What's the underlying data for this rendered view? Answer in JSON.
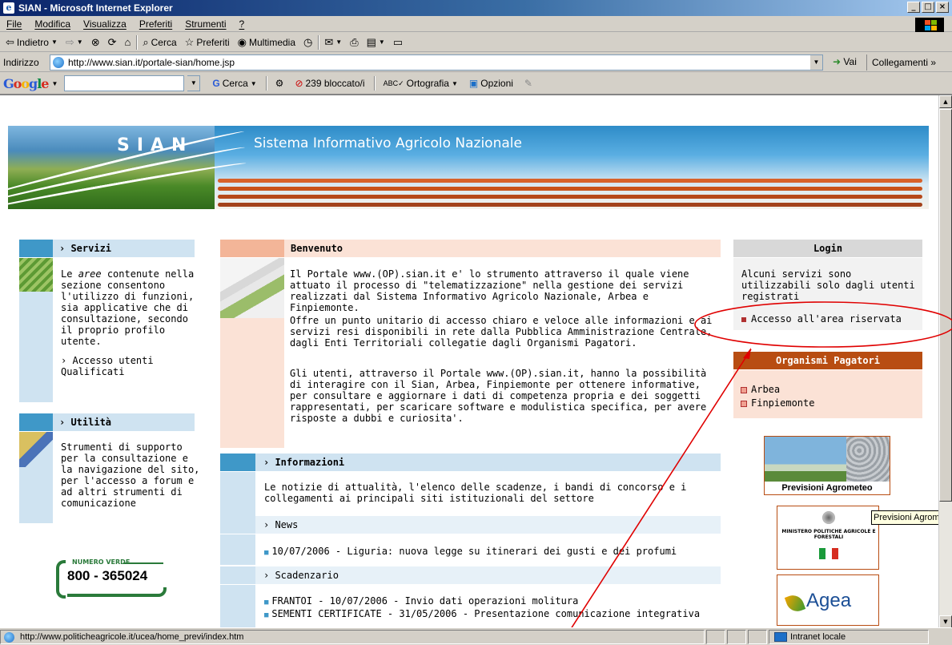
{
  "window": {
    "title": "SIAN - Microsoft Internet Explorer",
    "controls": [
      "_",
      "□",
      "×"
    ]
  },
  "menubar": {
    "items": [
      "File",
      "Modifica",
      "Visualizza",
      "Preferiti",
      "Strumenti",
      "?"
    ]
  },
  "toolbar": {
    "back_label": "Indietro",
    "search_label": "Cerca",
    "favorites_label": "Preferiti",
    "media_label": "Multimedia"
  },
  "addressbar": {
    "label": "Indirizzo",
    "url": "http://www.sian.it/portale-sian/home.jsp",
    "go_label": "Vai",
    "links_label": "Collegamenti"
  },
  "googlebar": {
    "logo_letters": [
      "G",
      "o",
      "o",
      "g",
      "l",
      "e"
    ],
    "search_placeholder": "",
    "search_label": "Cerca",
    "blocked_label": "239 bloccato/i",
    "spell_label": "Ortografia",
    "options_label": "Opzioni"
  },
  "page": {
    "site_logo": "SIAN",
    "site_title": "Sistema Informativo Agricolo Nazionale",
    "servizi": {
      "heading": "› Servizi",
      "text_before": "Le ",
      "text_em": "aree",
      "text_after": " contenute nella sezione consentono l'utilizzo di funzioni, sia applicative che di consultazione, secondo il proprio profilo utente.",
      "link": "› Accesso utenti Qualificati"
    },
    "utilita": {
      "heading": "› Utilità",
      "text": "Strumenti di supporto per la consultazione e la navigazione del sito, per l'accesso a forum e ad altri strumenti di comunicazione"
    },
    "numero_verde": {
      "label": "NUMERO VERDE",
      "number": "800 - 365024"
    },
    "benvenuto": {
      "heading": "Benvenuto",
      "p1": "Il Portale www.(OP).sian.it e' lo strumento attraverso il quale viene attuato il processo di \"telematizzazione\" nella gestione dei servizi realizzati dal Sistema Informativo Agricolo Nazionale, Arbea e Finpiemonte.",
      "p2": "Offre un punto unitario di accesso chiaro e veloce alle informazioni e ai servizi resi disponibili in rete dalla Pubblica Amministrazione Centrale, dagli Enti Territoriali collegatie dagli Organismi Pagatori.",
      "p3": "Gli utenti, attraverso il Portale www.(OP).sian.it, hanno la possibilità di interagire con il Sian, Arbea, Finpiemonte per ottenere informative, per consultare e aggiornare i dati di competenza propria e dei soggetti rappresentati, per scaricare software e modulistica specifica, per avere risposte a dubbi e curiosita'."
    },
    "informazioni": {
      "heading": "› Informazioni",
      "text": "Le notizie di attualità, l'elenco delle scadenze, i bandi di concorso e i collegamenti ai principali siti istituzionali del settore",
      "news_label": "› News",
      "news": [
        "10/07/2006 - Liguria: nuova legge su itinerari dei gusti e dei profumi"
      ],
      "scadenzario_label": "› Scadenzario",
      "scadenze": [
        "FRANTOI - 10/07/2006 - Invio dati operazioni molitura",
        "SEMENTI CERTIFICATE - 31/05/2006 - Presentazione comunicazione integrativa"
      ]
    },
    "login": {
      "heading": "Login",
      "text": "Alcuni servizi sono utilizzabili solo dagli utenti registrati",
      "link": "Accesso all'area riservata"
    },
    "organismi": {
      "heading": "Organismi Pagatori",
      "items": [
        "Arbea",
        "Finpiemonte"
      ]
    },
    "agrometeo_caption": "Previsioni Agrometeo",
    "tooltip": "Previsioni Agrometeo",
    "ministero_text": "MINISTERO POLITICHE AGRICOLE E FORESTALI",
    "agea_text": "Agea"
  },
  "statusbar": {
    "url": "http://www.politicheagricole.it/ucea/home_previ/index.htm",
    "zone": "Intranet locale"
  },
  "colors": {
    "titlebar": "#0a246a",
    "blue_panel": "#3f98c8",
    "light_blue_panel": "#cfe3f1",
    "salmon_panel": "#fbe2d6",
    "orange_head": "#b84d12",
    "annotation_red": "#e00000"
  },
  "icons": {
    "back": "arrow-left-icon",
    "forward": "arrow-right-icon",
    "stop": "stop-icon",
    "refresh": "refresh-icon",
    "home": "home-icon",
    "search": "search-icon",
    "favorites": "star-icon",
    "media": "media-icon",
    "history": "history-icon",
    "mail": "mail-icon",
    "print": "print-icon",
    "edit": "edit-icon"
  }
}
